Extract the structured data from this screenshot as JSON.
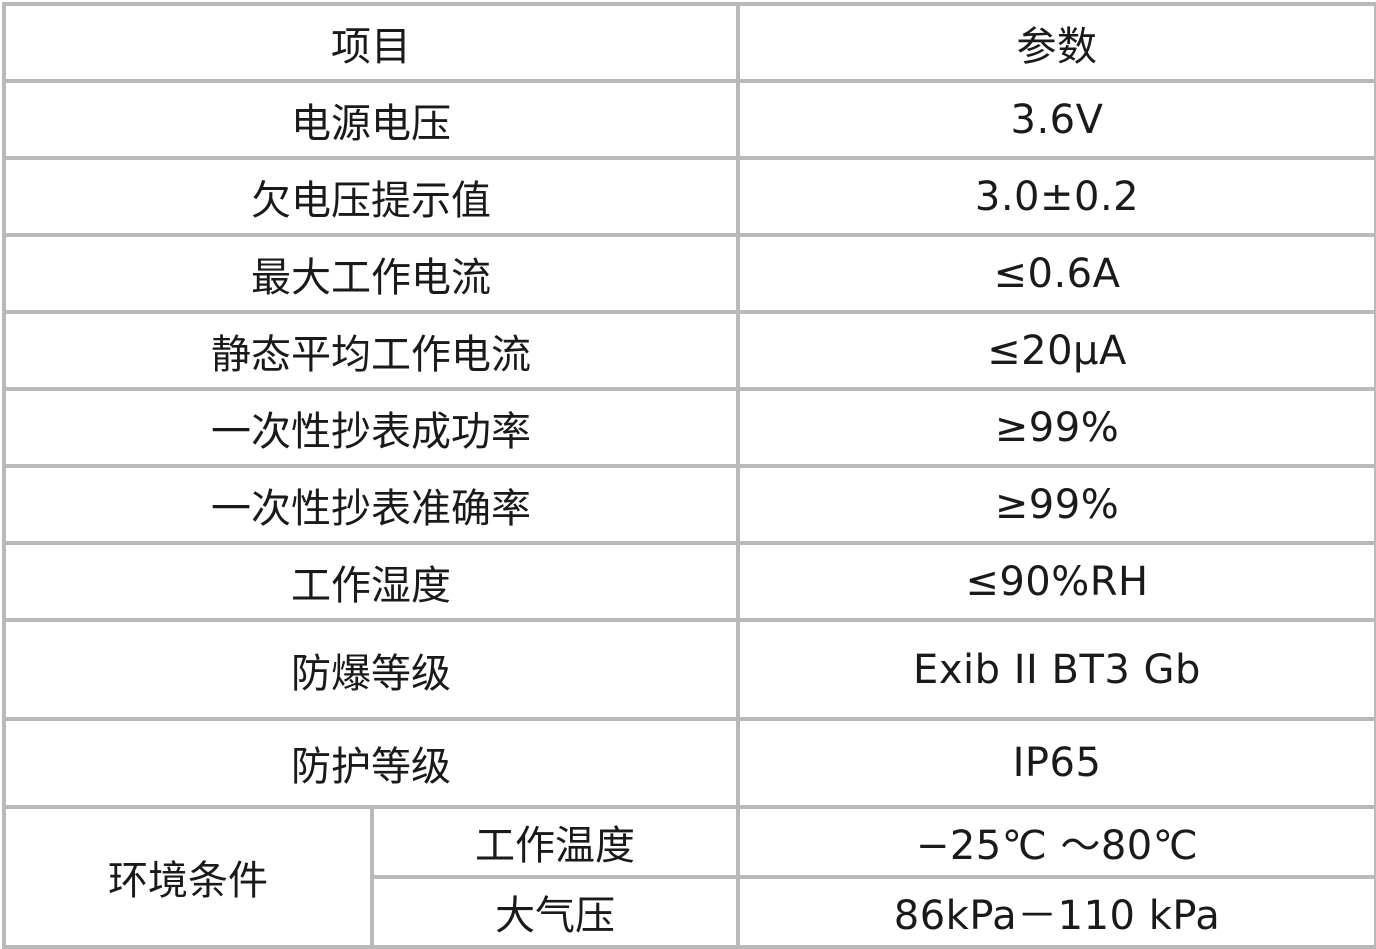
{
  "header": {
    "item": "项目",
    "param": "参数"
  },
  "rows": [
    {
      "item": "电源电压",
      "value": "3.6V"
    },
    {
      "item": "欠电压提示值",
      "value": "3.0±0.2"
    },
    {
      "item": "最大工作电流",
      "value": "≤0.6A"
    },
    {
      "item": "静态平均工作电流",
      "value": "≤20μA"
    },
    {
      "item": "一次性抄表成功率",
      "value": "≥99%"
    },
    {
      "item": "一次性抄表准确率",
      "value": "≥99%"
    },
    {
      "item": "工作湿度",
      "value": "≤90%RH"
    },
    {
      "item": "防爆等级",
      "value": "Exib II BT3 Gb"
    },
    {
      "item": "防护等级",
      "value": "IP65"
    }
  ],
  "environment": {
    "group": "环境条件",
    "sub": [
      {
        "item": "工作温度",
        "value": "−25℃ ～80℃"
      },
      {
        "item": "大气压",
        "value": "86kPa－110 kPa"
      }
    ]
  }
}
